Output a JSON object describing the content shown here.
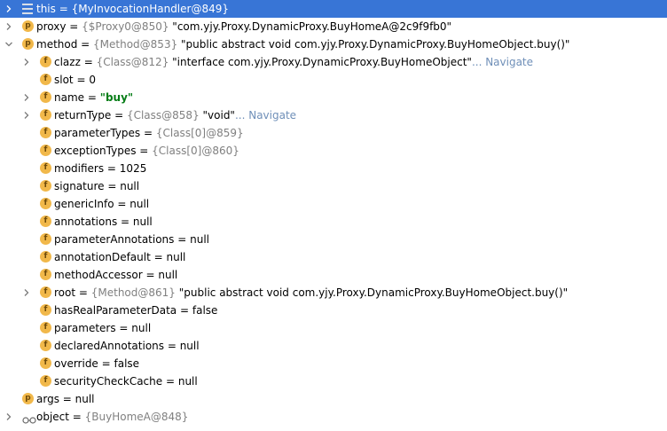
{
  "rows": [
    {
      "depth": 0,
      "arrow": "collapsed",
      "icon": "lines",
      "name": "this",
      "eq": " = ",
      "ref": "{MyInvocationHandler@849}",
      "val": "",
      "nav": "",
      "selected": true
    },
    {
      "depth": 0,
      "arrow": "collapsed",
      "icon": "p",
      "name": "proxy",
      "eq": " = ",
      "ref": "{$Proxy0@850} ",
      "val": "\"com.yjy.Proxy.DynamicProxy.BuyHomeA@2c9f9fb0\"",
      "nav": ""
    },
    {
      "depth": 0,
      "arrow": "expanded",
      "icon": "p",
      "name": "method",
      "eq": " = ",
      "ref": "{Method@853} ",
      "val": "\"public abstract void com.yjy.Proxy.DynamicProxy.BuyHomeObject.buy()\"",
      "nav": ""
    },
    {
      "depth": 1,
      "arrow": "collapsed",
      "icon": "f",
      "name": "clazz",
      "eq": " = ",
      "ref": "{Class@812} ",
      "val": "\"interface com.yjy.Proxy.DynamicProxy.BuyHomeObject\"",
      "nav": "... Navigate"
    },
    {
      "depth": 1,
      "arrow": "",
      "icon": "f",
      "name": "slot",
      "eq": " = ",
      "ref": "",
      "val": "0",
      "nav": ""
    },
    {
      "depth": 1,
      "arrow": "collapsed",
      "icon": "f",
      "name": "name",
      "eq": " = ",
      "ref": "",
      "val": "\"buy\"",
      "valClass": "str-green",
      "nav": ""
    },
    {
      "depth": 1,
      "arrow": "collapsed",
      "icon": "f",
      "name": "returnType",
      "eq": " = ",
      "ref": "{Class@858} ",
      "val": "\"void\"",
      "nav": "... Navigate"
    },
    {
      "depth": 1,
      "arrow": "",
      "icon": "f",
      "name": "parameterTypes",
      "eq": " = ",
      "ref": "{Class[0]@859}",
      "val": "",
      "nav": ""
    },
    {
      "depth": 1,
      "arrow": "",
      "icon": "f",
      "name": "exceptionTypes",
      "eq": " = ",
      "ref": "{Class[0]@860}",
      "val": "",
      "nav": ""
    },
    {
      "depth": 1,
      "arrow": "",
      "icon": "f",
      "name": "modifiers",
      "eq": " = ",
      "ref": "",
      "val": "1025",
      "nav": ""
    },
    {
      "depth": 1,
      "arrow": "",
      "icon": "f",
      "name": "signature",
      "eq": " = ",
      "ref": "",
      "val": "null",
      "nav": ""
    },
    {
      "depth": 1,
      "arrow": "",
      "icon": "f",
      "name": "genericInfo",
      "eq": " = ",
      "ref": "",
      "val": "null",
      "nav": ""
    },
    {
      "depth": 1,
      "arrow": "",
      "icon": "f",
      "name": "annotations",
      "eq": " = ",
      "ref": "",
      "val": "null",
      "nav": ""
    },
    {
      "depth": 1,
      "arrow": "",
      "icon": "f",
      "name": "parameterAnnotations",
      "eq": " = ",
      "ref": "",
      "val": "null",
      "nav": ""
    },
    {
      "depth": 1,
      "arrow": "",
      "icon": "f",
      "name": "annotationDefault",
      "eq": " = ",
      "ref": "",
      "val": "null",
      "nav": ""
    },
    {
      "depth": 1,
      "arrow": "",
      "icon": "f",
      "name": "methodAccessor",
      "eq": " = ",
      "ref": "",
      "val": "null",
      "nav": ""
    },
    {
      "depth": 1,
      "arrow": "collapsed",
      "icon": "f",
      "name": "root",
      "eq": " = ",
      "ref": "{Method@861} ",
      "val": "\"public abstract void com.yjy.Proxy.DynamicProxy.BuyHomeObject.buy()\"",
      "nav": ""
    },
    {
      "depth": 1,
      "arrow": "",
      "icon": "f",
      "name": "hasRealParameterData",
      "eq": " = ",
      "ref": "",
      "val": "false",
      "nav": ""
    },
    {
      "depth": 1,
      "arrow": "",
      "icon": "f",
      "name": "parameters",
      "eq": " = ",
      "ref": "",
      "val": "null",
      "nav": ""
    },
    {
      "depth": 1,
      "arrow": "",
      "icon": "f",
      "name": "declaredAnnotations",
      "eq": " = ",
      "ref": "",
      "val": "null",
      "nav": ""
    },
    {
      "depth": 1,
      "arrow": "",
      "icon": "f",
      "name": "override",
      "eq": " = ",
      "ref": "",
      "val": "false",
      "nav": ""
    },
    {
      "depth": 1,
      "arrow": "",
      "icon": "f",
      "name": "securityCheckCache",
      "eq": " = ",
      "ref": "",
      "val": "null",
      "nav": ""
    },
    {
      "depth": 0,
      "arrow": "",
      "icon": "p",
      "name": "args",
      "eq": " = ",
      "ref": "",
      "val": "null",
      "nav": ""
    },
    {
      "depth": 0,
      "arrow": "collapsed",
      "icon": "glasses",
      "name": "object",
      "eq": " = ",
      "ref": "{BuyHomeA@848}",
      "val": "",
      "nav": ""
    }
  ],
  "icons": {
    "p": "p",
    "f": "f"
  },
  "colors": {
    "selection": "#3875d6",
    "field_icon": "#f1b84a",
    "string_value": "#067d17",
    "navigate_link": "#6f8fb8",
    "reference": "#808080"
  }
}
